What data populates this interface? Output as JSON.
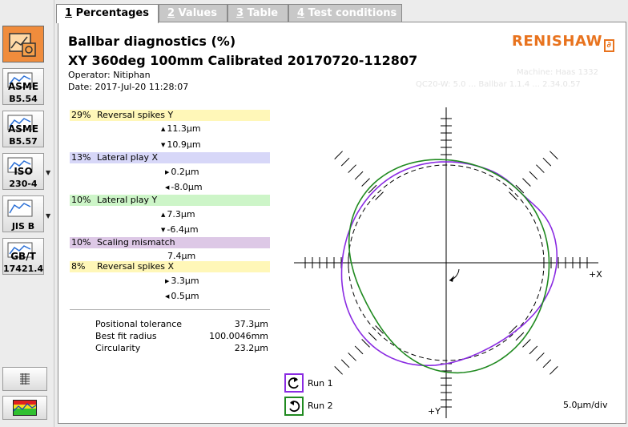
{
  "tabs": [
    {
      "num": "1",
      "label": "Percentages"
    },
    {
      "num": "2",
      "label": "Values"
    },
    {
      "num": "3",
      "label": "Table"
    },
    {
      "num": "4",
      "label": "Test conditions"
    }
  ],
  "toolbar": {
    "asme554_label": "ASME\nB5.54",
    "asme557_label": "ASME\nB5.57",
    "iso_label": "ISO\n230-4",
    "jis_label": "JIS B",
    "gbt_label": "GB/T\n17421.4"
  },
  "header": {
    "title": "Ballbar diagnostics (%)",
    "subtitle": "XY 360deg 100mm Calibrated 20170720-112807",
    "operator": "Operator: Nitiphan",
    "date": "Date: 2017-Jul-20 11:28:07",
    "brand": "RENISHAW",
    "ghost_line1": "Machine: Haas 1332",
    "ghost_line2": "QC20-W: 5.0 ... Ballbar 1.1.4 ... 2.34.0.57"
  },
  "diagnostics": [
    {
      "pct": "29%",
      "label": "Reversal spikes Y",
      "color": "#fff7b8",
      "values": [
        "11.3µm",
        "10.9µm"
      ],
      "arrows": [
        "up",
        "down"
      ]
    },
    {
      "pct": "13%",
      "label": "Lateral play X",
      "color": "#d7d7f8",
      "values": [
        "0.2µm",
        "-8.0µm"
      ],
      "arrows": [
        "right",
        "left"
      ]
    },
    {
      "pct": "10%",
      "label": "Lateral play Y",
      "color": "#cdf5c8",
      "values": [
        "7.3µm",
        "-6.4µm"
      ],
      "arrows": [
        "up",
        "down"
      ]
    },
    {
      "pct": "10%",
      "label": "Scaling mismatch",
      "color": "#ddc8e6",
      "values": [
        "7.4µm"
      ],
      "arrows": []
    },
    {
      "pct": "8%",
      "label": "Reversal spikes X",
      "color": "#fff7b8",
      "values": [
        "3.3µm",
        "0.5µm"
      ],
      "arrows": [
        "right",
        "left"
      ]
    }
  ],
  "summary": [
    {
      "label": "Positional tolerance",
      "value": "37.3µm"
    },
    {
      "label": "Best fit radius",
      "value": "100.0046mm"
    },
    {
      "label": "Circularity",
      "value": "23.2µm"
    }
  ],
  "plot": {
    "x_axis_label": "+X",
    "y_axis_label": "+Y",
    "scale_label": "5.0µm/div",
    "runs": [
      {
        "name": "Run 1",
        "color": "#8a2be2"
      },
      {
        "name": "Run 2",
        "color": "#208a20"
      }
    ]
  }
}
